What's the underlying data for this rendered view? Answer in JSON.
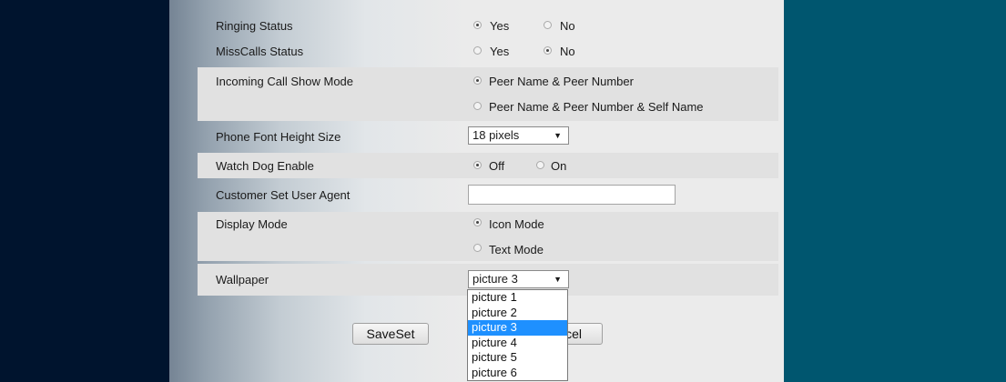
{
  "rows": {
    "ringing_status": {
      "label": "Ringing Status",
      "options": [
        "Yes",
        "No"
      ],
      "selected": "Yes"
    },
    "misscalls_status": {
      "label": "MissCalls Status",
      "options": [
        "Yes",
        "No"
      ],
      "selected": "No"
    },
    "incoming_call_show_mode": {
      "label": "Incoming Call Show Mode",
      "options": [
        "Peer Name & Peer Number",
        "Peer Name & Peer Number & Self Name"
      ],
      "selected": "Peer Name & Peer Number"
    },
    "phone_font_height_size": {
      "label": "Phone Font Height Size",
      "value": "18 pixels"
    },
    "watch_dog_enable": {
      "label": "Watch Dog Enable",
      "options": [
        "Off",
        "On"
      ],
      "selected": "Off"
    },
    "customer_set_user_agent": {
      "label": "Customer Set User Agent",
      "value": ""
    },
    "display_mode": {
      "label": "Display Mode",
      "options": [
        "Icon Mode",
        "Text Mode"
      ],
      "selected": "Icon Mode"
    },
    "wallpaper": {
      "label": "Wallpaper",
      "value": "picture 3"
    }
  },
  "wallpaper_dropdown": {
    "options": [
      "picture 1",
      "picture 2",
      "picture 3",
      "picture 4",
      "picture 5",
      "picture 6"
    ],
    "highlighted": "picture 3"
  },
  "buttons": {
    "save": "SaveSet",
    "cancel_visible_fragment": "cel"
  },
  "icons": {
    "caret": "chevron-down-icon",
    "radio": "radio-button"
  },
  "colors": {
    "left_band": "#00142e",
    "right_band": "#00566f",
    "row_bg": "#e1e1e1",
    "highlight": "#1e90ff"
  }
}
